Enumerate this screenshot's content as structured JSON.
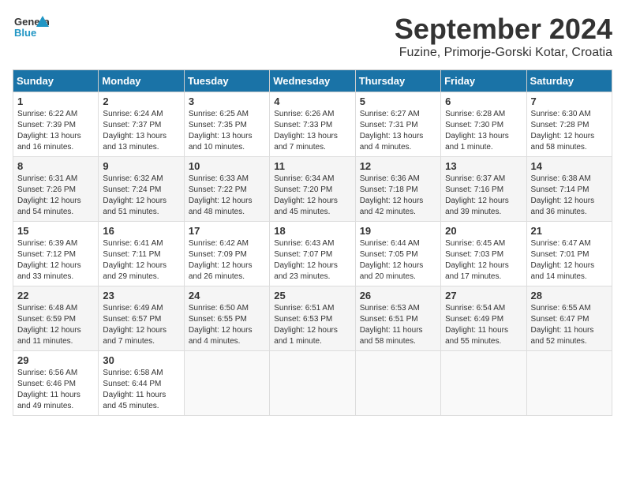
{
  "header": {
    "logo_line1": "General",
    "logo_line2": "Blue",
    "month_title": "September 2024",
    "location": "Fuzine, Primorje-Gorski Kotar, Croatia"
  },
  "calendar": {
    "headers": [
      "Sunday",
      "Monday",
      "Tuesday",
      "Wednesday",
      "Thursday",
      "Friday",
      "Saturday"
    ],
    "weeks": [
      [
        {
          "day": "1",
          "info": "Sunrise: 6:22 AM\nSunset: 7:39 PM\nDaylight: 13 hours\nand 16 minutes."
        },
        {
          "day": "2",
          "info": "Sunrise: 6:24 AM\nSunset: 7:37 PM\nDaylight: 13 hours\nand 13 minutes."
        },
        {
          "day": "3",
          "info": "Sunrise: 6:25 AM\nSunset: 7:35 PM\nDaylight: 13 hours\nand 10 minutes."
        },
        {
          "day": "4",
          "info": "Sunrise: 6:26 AM\nSunset: 7:33 PM\nDaylight: 13 hours\nand 7 minutes."
        },
        {
          "day": "5",
          "info": "Sunrise: 6:27 AM\nSunset: 7:31 PM\nDaylight: 13 hours\nand 4 minutes."
        },
        {
          "day": "6",
          "info": "Sunrise: 6:28 AM\nSunset: 7:30 PM\nDaylight: 13 hours\nand 1 minute."
        },
        {
          "day": "7",
          "info": "Sunrise: 6:30 AM\nSunset: 7:28 PM\nDaylight: 12 hours\nand 58 minutes."
        }
      ],
      [
        {
          "day": "8",
          "info": "Sunrise: 6:31 AM\nSunset: 7:26 PM\nDaylight: 12 hours\nand 54 minutes."
        },
        {
          "day": "9",
          "info": "Sunrise: 6:32 AM\nSunset: 7:24 PM\nDaylight: 12 hours\nand 51 minutes."
        },
        {
          "day": "10",
          "info": "Sunrise: 6:33 AM\nSunset: 7:22 PM\nDaylight: 12 hours\nand 48 minutes."
        },
        {
          "day": "11",
          "info": "Sunrise: 6:34 AM\nSunset: 7:20 PM\nDaylight: 12 hours\nand 45 minutes."
        },
        {
          "day": "12",
          "info": "Sunrise: 6:36 AM\nSunset: 7:18 PM\nDaylight: 12 hours\nand 42 minutes."
        },
        {
          "day": "13",
          "info": "Sunrise: 6:37 AM\nSunset: 7:16 PM\nDaylight: 12 hours\nand 39 minutes."
        },
        {
          "day": "14",
          "info": "Sunrise: 6:38 AM\nSunset: 7:14 PM\nDaylight: 12 hours\nand 36 minutes."
        }
      ],
      [
        {
          "day": "15",
          "info": "Sunrise: 6:39 AM\nSunset: 7:12 PM\nDaylight: 12 hours\nand 33 minutes."
        },
        {
          "day": "16",
          "info": "Sunrise: 6:41 AM\nSunset: 7:11 PM\nDaylight: 12 hours\nand 29 minutes."
        },
        {
          "day": "17",
          "info": "Sunrise: 6:42 AM\nSunset: 7:09 PM\nDaylight: 12 hours\nand 26 minutes."
        },
        {
          "day": "18",
          "info": "Sunrise: 6:43 AM\nSunset: 7:07 PM\nDaylight: 12 hours\nand 23 minutes."
        },
        {
          "day": "19",
          "info": "Sunrise: 6:44 AM\nSunset: 7:05 PM\nDaylight: 12 hours\nand 20 minutes."
        },
        {
          "day": "20",
          "info": "Sunrise: 6:45 AM\nSunset: 7:03 PM\nDaylight: 12 hours\nand 17 minutes."
        },
        {
          "day": "21",
          "info": "Sunrise: 6:47 AM\nSunset: 7:01 PM\nDaylight: 12 hours\nand 14 minutes."
        }
      ],
      [
        {
          "day": "22",
          "info": "Sunrise: 6:48 AM\nSunset: 6:59 PM\nDaylight: 12 hours\nand 11 minutes."
        },
        {
          "day": "23",
          "info": "Sunrise: 6:49 AM\nSunset: 6:57 PM\nDaylight: 12 hours\nand 7 minutes."
        },
        {
          "day": "24",
          "info": "Sunrise: 6:50 AM\nSunset: 6:55 PM\nDaylight: 12 hours\nand 4 minutes."
        },
        {
          "day": "25",
          "info": "Sunrise: 6:51 AM\nSunset: 6:53 PM\nDaylight: 12 hours\nand 1 minute."
        },
        {
          "day": "26",
          "info": "Sunrise: 6:53 AM\nSunset: 6:51 PM\nDaylight: 11 hours\nand 58 minutes."
        },
        {
          "day": "27",
          "info": "Sunrise: 6:54 AM\nSunset: 6:49 PM\nDaylight: 11 hours\nand 55 minutes."
        },
        {
          "day": "28",
          "info": "Sunrise: 6:55 AM\nSunset: 6:47 PM\nDaylight: 11 hours\nand 52 minutes."
        }
      ],
      [
        {
          "day": "29",
          "info": "Sunrise: 6:56 AM\nSunset: 6:46 PM\nDaylight: 11 hours\nand 49 minutes."
        },
        {
          "day": "30",
          "info": "Sunrise: 6:58 AM\nSunset: 6:44 PM\nDaylight: 11 hours\nand 45 minutes."
        },
        {
          "day": "",
          "info": ""
        },
        {
          "day": "",
          "info": ""
        },
        {
          "day": "",
          "info": ""
        },
        {
          "day": "",
          "info": ""
        },
        {
          "day": "",
          "info": ""
        }
      ]
    ]
  }
}
